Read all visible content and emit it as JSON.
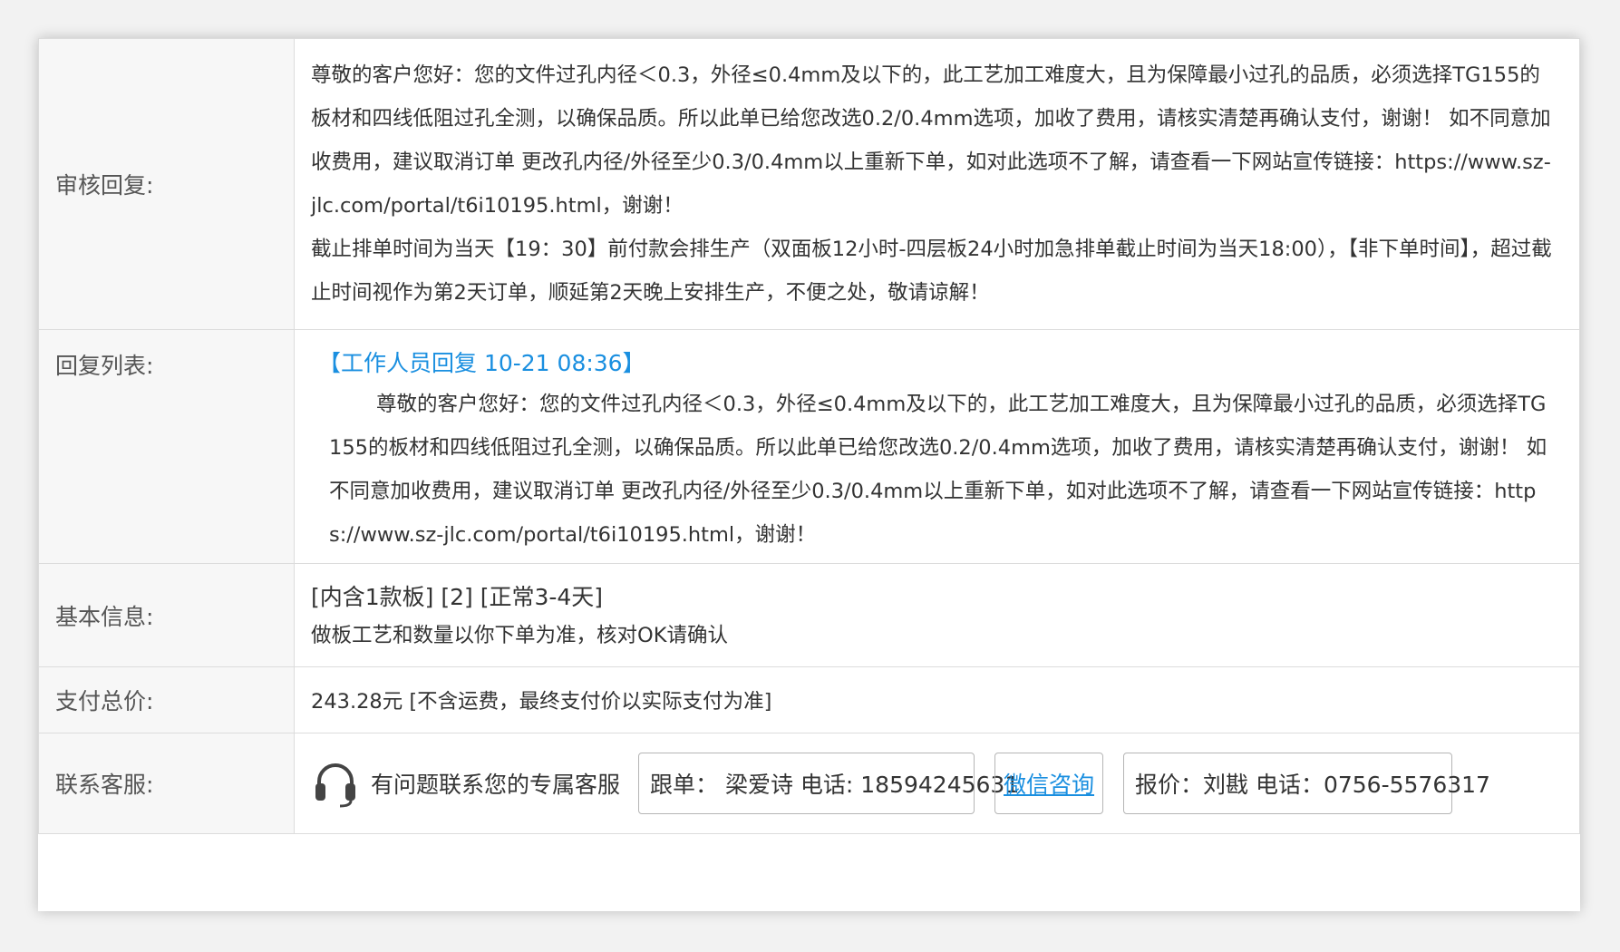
{
  "rows": {
    "review": {
      "label": "审核回复:",
      "para1": "尊敬的客户您好：您的文件过孔内径＜0.3，外径≤0.4mm及以下的，此工艺加工难度大，且为保障最小过孔的品质，必须选择TG155的板材和四线低阻过孔全测，以确保品质。所以此单已给您改选0.2/0.4mm选项，加收了费用，请核实清楚再确认支付，谢谢！ 如不同意加收费用，建议取消订单 更改孔内径/外径至少0.3/0.4mm以上重新下单，如对此选项不了解，请查看一下网站宣传链接：https://www.sz-jlc.com/portal/t6i10195.html，谢谢！",
      "para2": "截止排单时间为当天【19：30】前付款会排生产（双面板12小时-四层板24小时加急排单截止时间为当天18:00），【非下单时间】，超过截止时间视作为第2天订单，顺延第2天晚上安排生产，不便之处，敬请谅解！"
    },
    "replies": {
      "label": "回复列表:",
      "head": "【工作人员回复 10-21 08:36】",
      "body": "尊敬的客户您好：您的文件过孔内径＜0.3，外径≤0.4mm及以下的，此工艺加工难度大，且为保障最小过孔的品质，必须选择TG155的板材和四线低阻过孔全测，以确保品质。所以此单已给您改选0.2/0.4mm选项，加收了费用，请核实清楚再确认支付，谢谢！ 如不同意加收费用，建议取消订单 更改孔内径/外径至少0.3/0.4mm以上重新下单，如对此选项不了解，请查看一下网站宣传链接：https://www.sz-jlc.com/portal/t6i10195.html，谢谢！"
    },
    "basic": {
      "label": "基本信息:",
      "line1": "[内含1款板]  [2]  [正常3-4天]",
      "line2": "做板工艺和数量以你下单为准，核对OK请确认"
    },
    "payment": {
      "label": "支付总价:",
      "value": "243.28元 [不含运费，最终支付价以实际支付为准]"
    },
    "contact": {
      "label": "联系客服:",
      "icon": "headset-icon",
      "text": "有问题联系您的专属客服",
      "follow": "跟单： 梁爱诗 电话: 18594245631",
      "wechat": "微信咨询",
      "quote": "报价：刘戡 电话：0756-5576317"
    }
  },
  "colors": {
    "alert_red": "#e8141b",
    "link_blue": "#1a8fe0",
    "label_bg": "#f7f7f7",
    "border": "#dcdcdc"
  }
}
